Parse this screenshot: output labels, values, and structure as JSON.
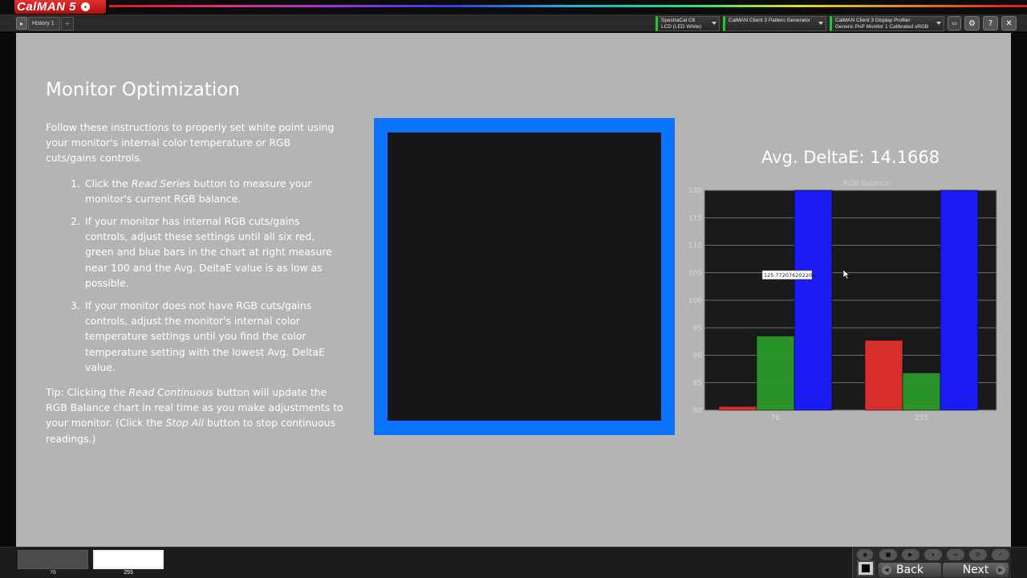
{
  "app": {
    "logo_text": "CalMAN 5",
    "logo_arrow": "▾"
  },
  "history": {
    "toggle_icon": "▸",
    "tab_label": "History 1",
    "add_icon": "+"
  },
  "devices": [
    {
      "line1": "SpectraCal C6",
      "line2": "LCD (LED White)"
    },
    {
      "line1": "CalMAN Client 3 Pattern Generator",
      "line2": ""
    },
    {
      "line1": "CalMAN Client 3 Display Profiler",
      "line2": "Generic PnP Monitor 1 Calibrated sRGB"
    }
  ],
  "toolbar_icons": {
    "settings": "⚙",
    "help": "?",
    "close": "✕"
  },
  "page": {
    "title": "Monitor Optimization",
    "intro": "Follow these instructions to properly set white point using your monitor's internal color temperature or RGB cuts/gains controls.",
    "steps": [
      {
        "num": "1.",
        "pre": "Click the ",
        "em": "Read Series",
        "post": " button to measure your monitor's current RGB balance."
      },
      {
        "num": "2.",
        "pre": "If your monitor has internal RGB cuts/gains controls, adjust these settings until all six red, green and blue bars in the chart at right measure near 100 and the Avg. DeltaE value is as low as possible.",
        "em": "",
        "post": ""
      },
      {
        "num": "3.",
        "pre": "If your monitor does not have RGB cuts/gains controls, adjust the monitor's internal color temperature settings until you find the color temperature setting with the lowest Avg. DeltaE value.",
        "em": "",
        "post": ""
      }
    ],
    "tip_pre": "Tip: Clicking the ",
    "tip_em1": "Read Continuous",
    "tip_mid": " button will update the RGB Balance chart in real time as you make adjustments to your monitor. (Click the ",
    "tip_em2": "Stop All",
    "tip_post": " button to stop continuous readings.)",
    "avg_delta": "Avg. DeltaE: 14.1668"
  },
  "colors": {
    "pattern_border": "#0a73ff",
    "pattern_fill": "#161616",
    "red": "#e23030",
    "green": "#2a9a2a",
    "blue": "#1a1aff"
  },
  "chart_data": {
    "type": "bar",
    "title": "RGB Balance",
    "categories": [
      "76",
      "255"
    ],
    "series": [
      {
        "name": "Red",
        "values": [
          80.7,
          92.7
        ]
      },
      {
        "name": "Green",
        "values": [
          93.5,
          86.8
        ]
      },
      {
        "name": "Blue",
        "values": [
          125.772076202204,
          124
        ]
      }
    ],
    "ylim": [
      80,
      120
    ],
    "yticks": [
      80,
      85,
      90,
      95,
      100,
      105,
      110,
      115,
      120
    ],
    "grid": true,
    "tooltip": "125.772076202204"
  },
  "bottom": {
    "thumbs": [
      {
        "label": "76",
        "color": "#4c4c4c"
      },
      {
        "label": "255",
        "color": "#ffffff"
      }
    ],
    "back_label": "Back",
    "next_label": "Next"
  }
}
